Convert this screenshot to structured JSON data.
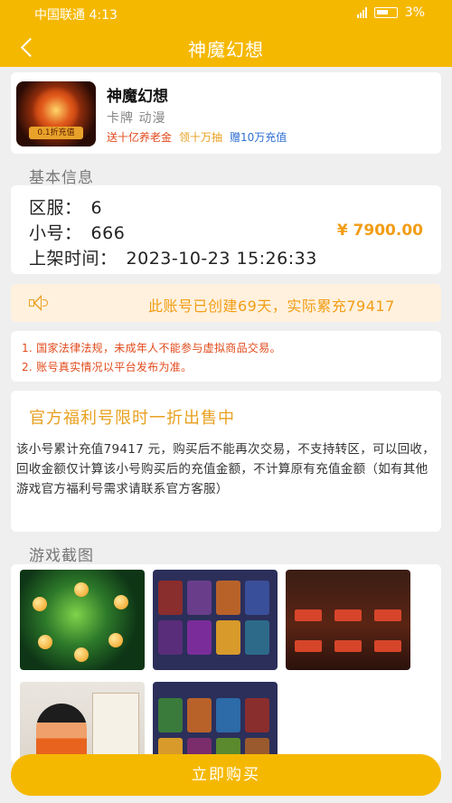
{
  "status_bar": {
    "carrier_time": "中国联通 4:13",
    "battery": "3%"
  },
  "nav": {
    "title": "神魔幻想"
  },
  "game": {
    "name": "神魔幻想",
    "categories": "卡牌  动漫",
    "icon_tag": "0.1折充值",
    "tags": [
      "送十亿养老金",
      "领十万抽",
      "赠10万充值"
    ]
  },
  "basic_info": {
    "section_title": "基本信息",
    "server_label": "区服：",
    "server_value": "6",
    "account_label": "小号：",
    "account_value": "666",
    "price": "¥ 7900.00",
    "listed_label": "上架时间：",
    "listed_value": "2023-10-23 15:26:33"
  },
  "notice": {
    "text": "此账号已创建69天，实际累充79417"
  },
  "rules": [
    "1. 国家法律法规，未成年人不能参与虚拟商品交易。",
    "2. 账号真实情况以平台发布为准。"
  ],
  "promo": {
    "title": "官方福利号限时一折出售中",
    "description": "该小号累计充值79417 元，购买后不能再次交易，不支持转区，可以回收，回收金额仅计算该小号购买后的充值金额，不计算原有充值金额（如有其他游戏官方福利号需求请联系官方客服）"
  },
  "screenshots": {
    "section_title": "游戏截图"
  },
  "buy_button": {
    "label": "立即购买"
  },
  "colors": {
    "accent": "#f5b800",
    "price": "#f29d16",
    "warning": "#e24a1b",
    "link_blue": "#2f6fd1"
  }
}
